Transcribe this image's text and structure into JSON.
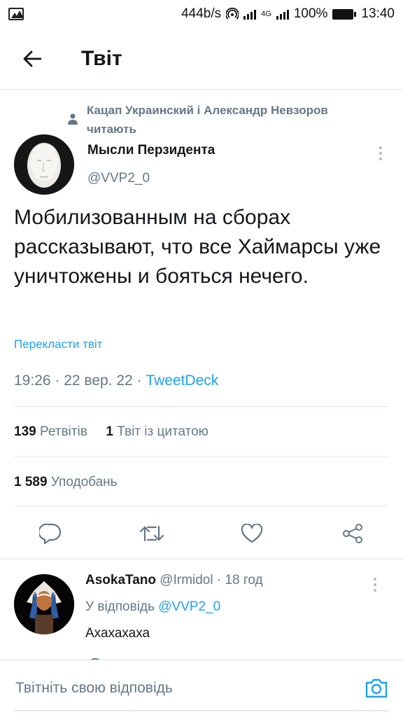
{
  "status_bar": {
    "speed": "444b/s",
    "network_type": "4G",
    "battery": "100%",
    "time": "13:40"
  },
  "header": {
    "title": "Твіт",
    "back_icon": "arrow-left-icon"
  },
  "tweet": {
    "social_context": "Кацап Украинский і Александр Невзоров читають",
    "author_name": "Мысли Перзидента",
    "author_handle": "@VVP2_0",
    "text": "Мобилизованным на сборах рассказывают, что все Хаймарсы уже уничтожены и бояться нечего.",
    "translate_label": "Перекласти твіт",
    "time": "19:26",
    "date": "22 вер. 22",
    "source": "TweetDeck",
    "retweets_count": "139",
    "retweets_label": "Ретвітів",
    "quotes_count": "1",
    "quotes_label": "Твіт із цитатою",
    "likes_count": "1 589",
    "likes_label": "Уподобань"
  },
  "reply": {
    "author_name": "AsokaTano",
    "author_handle": "@Irmidol",
    "age": "18 год",
    "reply_to_label": "У відповідь",
    "reply_to_handle": "@VVP2_0",
    "text": "Ахахахаха"
  },
  "compose": {
    "placeholder": "Твітніть свою відповідь"
  },
  "colors": {
    "accent": "#1da1f2",
    "secondary_text": "#657786",
    "primary_text": "#14171a",
    "divider": "#e1e8ed"
  }
}
